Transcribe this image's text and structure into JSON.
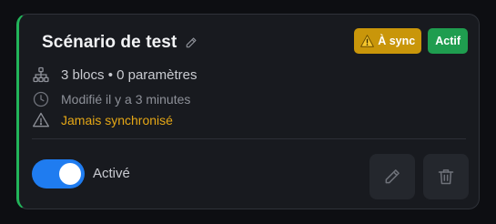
{
  "card": {
    "title": "Scénario de test",
    "badges": {
      "sync": "À sync",
      "status": "Actif"
    },
    "meta": {
      "blocks": "3 blocs • 0 paramètres",
      "modified": "Modifié il y a 3 minutes",
      "sync_status": "Jamais synchronisé"
    },
    "toggle": {
      "label": "Activé",
      "on": true
    }
  },
  "colors": {
    "accent_green": "#22b45a",
    "sync_badge": "#c9960a",
    "active_badge": "#1f9d4f",
    "warning_text": "#e5a716",
    "toggle_on": "#1f7cf0"
  },
  "icons": {
    "title_edit": "pencil-icon",
    "sync_badge": "warning-icon",
    "blocks": "sitemap-icon",
    "modified": "clock-icon",
    "sync_status": "warning-icon",
    "edit_action": "pencil-icon",
    "delete_action": "trash-icon"
  }
}
